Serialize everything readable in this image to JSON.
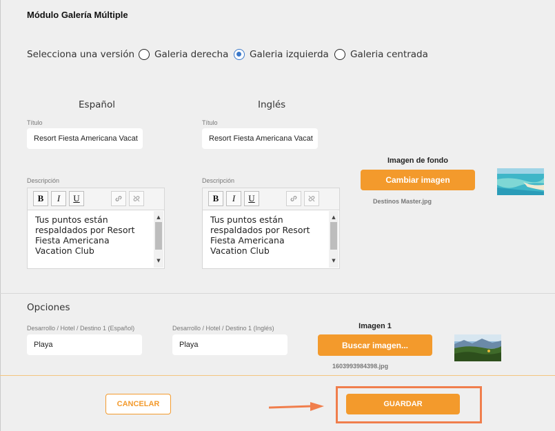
{
  "module_title": "Módulo Galería Múltiple",
  "version": {
    "label": "Selecciona una versión",
    "options": [
      {
        "label": "Galeria derecha",
        "selected": false
      },
      {
        "label": "Galeria izquierda",
        "selected": true
      },
      {
        "label": "Galeria centrada",
        "selected": false
      }
    ]
  },
  "spanish": {
    "heading": "Español",
    "title_label": "Título",
    "title_value": "Resort Fiesta Americana Vacat",
    "desc_label": "Descripción",
    "desc_value": "Tus puntos están respaldados por Resort Fiesta Americana Vacation Club"
  },
  "english": {
    "heading": "Inglés",
    "title_label": "Título",
    "title_value": "Resort Fiesta Americana Vacat",
    "desc_label": "Descripción",
    "desc_value": "Tus puntos están respaldados por Resort Fiesta Americana Vacation Club"
  },
  "toolbar": {
    "bold": "B",
    "italic": "I",
    "underline": "U",
    "link_icon": "link-icon",
    "unlink_icon": "unlink-icon"
  },
  "background_image": {
    "label": "Imagen de fondo",
    "button": "Cambiar imagen",
    "filename": "Destinos Master.jpg"
  },
  "options": {
    "heading": "Opciones",
    "field_es_label": "Desarrollo / Hotel / Destino 1 (Español)",
    "field_es_value": "Playa",
    "field_en_label": "Desarrollo / Hotel / Destino 1 (Inglés)",
    "field_en_value": "Playa",
    "image_label": "Imagen 1",
    "image_button": "Buscar imagen...",
    "image_filename": "1603993984398.jpg"
  },
  "footer": {
    "cancel": "CANCELAR",
    "save": "GUARDAR"
  },
  "colors": {
    "accent": "#f39a2c",
    "radio": "#3a78c9",
    "annotation": "#f07e4c"
  }
}
